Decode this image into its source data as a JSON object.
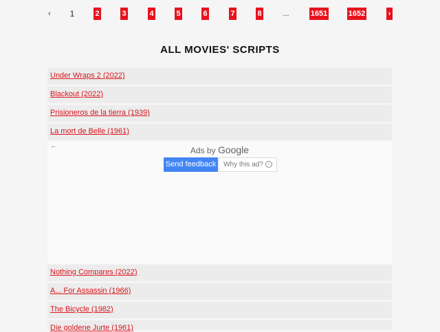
{
  "pagination": {
    "prev": "‹",
    "current": "1",
    "pages": [
      "2",
      "3",
      "4",
      "5",
      "6",
      "7",
      "8"
    ],
    "ellipsis": "...",
    "last_pages": [
      "1651",
      "1652"
    ],
    "next": "›"
  },
  "page_title": "ALL MOVIES' SCRIPTS",
  "movies_top": [
    "Under Wraps 2 (2022)",
    "Blackout (2022)",
    "Prisioneros de la tierra (1939)",
    "La mort de Belle (1961)"
  ],
  "ad": {
    "back_arrow": "←",
    "ads_by": "Ads by",
    "google": "Google",
    "send_feedback": "Send feedback",
    "why_this_ad": "Why this ad?",
    "info_glyph": "i"
  },
  "movies_bottom": [
    "Nothing Compares (2022)",
    "A... For Assassin (1966)",
    "The Bicycle (1982)",
    "Die goldene Jurte (1961)"
  ],
  "colors": {
    "accent_red": "#e8121c",
    "link_red": "#d9141c",
    "row_bg": "#ececec",
    "feedback_blue": "#4285f4"
  }
}
